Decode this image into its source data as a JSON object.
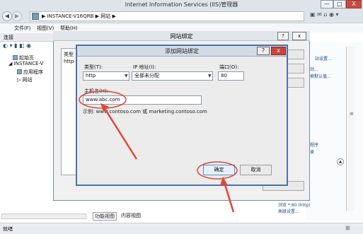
{
  "window": {
    "title": "Internet Information Services (IIS)管理器",
    "minimize": "—",
    "maximize": "□",
    "close": "X"
  },
  "address": {
    "back": "◀",
    "forward": "▶",
    "breadcrumb": "▶  INSTANCE-V16QRB  ▶  网站  ▶",
    "toolbar_icons": "▣ ✉ ⌂ ◉ ▾"
  },
  "menu": {
    "file": "文件(F)",
    "view": "视图(V)",
    "help": "帮助(H)"
  },
  "connections": {
    "header": "连接",
    "toolbar": "◐ ▾ ▮ ◧ ◉",
    "tree": [
      {
        "label": "起始页"
      },
      {
        "label": "◢ INSTANCE-V"
      },
      {
        "label": "应用程序"
      },
      {
        "label": "▷ 网站"
      }
    ]
  },
  "bottom_tabs": {
    "features": "功能视图",
    "content": "内容视图"
  },
  "status": {
    "text": "就绪",
    "grip": "⊞"
  },
  "actions_pane": {
    "items": [
      "站设置...",
      "动...",
      "索默认值...",
      "程序",
      "录",
      "浏览 *:80 (http)",
      "高级设置..."
    ],
    "scroll_marker": "≡",
    "scroll_up": "▲"
  },
  "site_bindings_dialog": {
    "title": "网站绑定",
    "help": "?",
    "close": "x",
    "column_type": "类型",
    "row_http": "http",
    "side_buttons": [
      "",
      "",
      ""
    ],
    "close_button": ""
  },
  "edit_binding_dialog": {
    "title": "添加网站绑定",
    "help": "?",
    "close": "x",
    "type_label": "类型(T):",
    "type_value": "http",
    "ip_label": "IP 地址(I):",
    "ip_value": "全部未分配",
    "port_label": "端口(O):",
    "port_value": "80",
    "host_label": "主机名(H):",
    "host_value": "www.abc.com",
    "example": "示例: www.contoso.com 或 marketing.contoso.com",
    "ok": "确定",
    "cancel": "取消"
  },
  "colors": {
    "annotation": "#e2453a",
    "title_bar": "#dde4ea",
    "dialog_border": "#4b72a8"
  }
}
